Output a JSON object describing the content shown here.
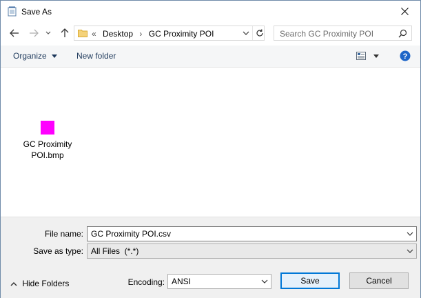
{
  "window": {
    "title": "Save As"
  },
  "address": {
    "overflow": "«",
    "crumbs": [
      "Desktop",
      "GC Proximity POI"
    ]
  },
  "search": {
    "placeholder": "Search GC Proximity POI"
  },
  "toolbar": {
    "organize": "Organize",
    "new_folder": "New folder"
  },
  "files": [
    {
      "name": "GC Proximity POI.bmp",
      "line1": "GC Proximity",
      "line2": "POI.bmp",
      "thumb_color": "#ff00ff"
    }
  ],
  "form": {
    "file_name_label": "File name:",
    "file_name_value": "GC Proximity POI.csv",
    "save_type_label": "Save as type:",
    "save_type_value": "All Files  (*.*)",
    "encoding_label": "Encoding:",
    "encoding_value": "ANSI"
  },
  "buttons": {
    "hide_folders": "Hide Folders",
    "save": "Save",
    "cancel": "Cancel"
  },
  "colors": {
    "accent": "#0078d7",
    "help": "#1e66c8",
    "link_text": "#1e395b"
  }
}
